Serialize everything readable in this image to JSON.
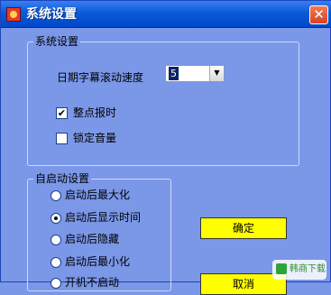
{
  "window": {
    "title": "系统设置",
    "close_glyph": "✕"
  },
  "system_group": {
    "legend": "系统设置",
    "scroll_speed_label": "日期字幕滚动速度",
    "scroll_speed_value": "5",
    "dropdown_arrow": "▼",
    "hourly_chime_label": "整点报时",
    "hourly_chime_checked": true,
    "lock_volume_label": "锁定音量",
    "lock_volume_checked": false,
    "check_glyph": "✔"
  },
  "startup_group": {
    "legend": "自启动设置",
    "options": [
      {
        "label": "启动后最大化",
        "checked": false
      },
      {
        "label": "启动后显示时间",
        "checked": true
      },
      {
        "label": "启动后隐藏",
        "checked": false
      },
      {
        "label": "启动后最小化",
        "checked": false
      },
      {
        "label": "开机不启动",
        "checked": false
      }
    ]
  },
  "buttons": {
    "ok_label": "确定",
    "cancel_label": "取消"
  },
  "watermark": {
    "text": "韩商下载"
  }
}
